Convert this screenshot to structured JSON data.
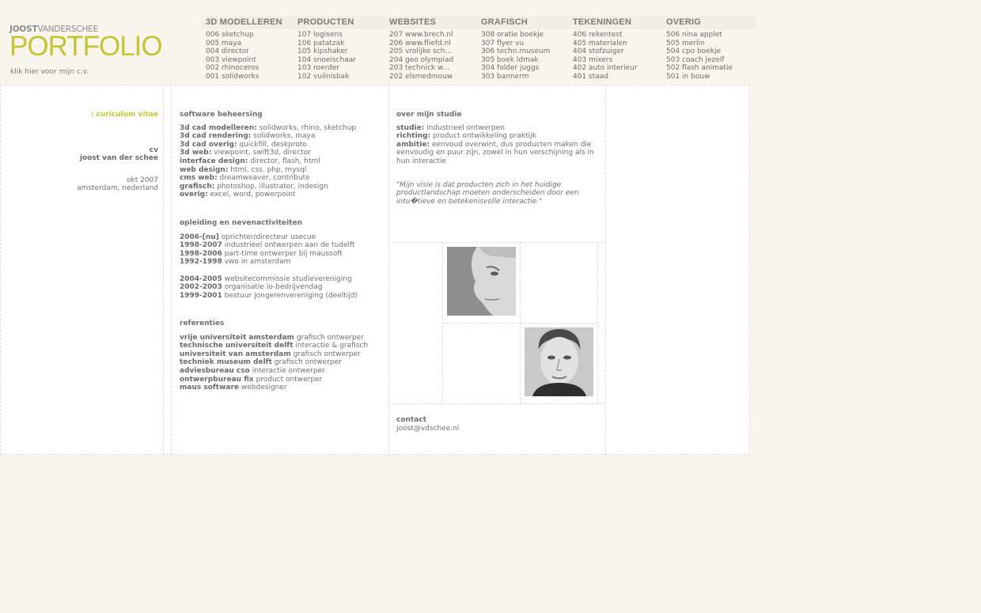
{
  "logo": {
    "top_bold": "JOOST",
    "top_thin": "VANDERSCHEE",
    "main": "PORTFOLIO"
  },
  "cv_link": "klik hier voor mijn c.v.",
  "nav": [
    {
      "title": "3D MODELLEREN",
      "items": [
        "006 sketchup",
        "005 maya",
        "004 director",
        "003 viewpoint",
        "002 rhinoceros",
        "001 solidworks"
      ]
    },
    {
      "title": "PRODUCTEN",
      "items": [
        "107 logisens",
        "106 patatzak",
        "105 kipshaker",
        "104 snoeischaar",
        "103 roerder",
        "102 vuilnisbak"
      ]
    },
    {
      "title": "WEBSITES",
      "items": [
        "207 www.brech.nl",
        "206 www.fliefd.nl",
        "205 vrolijke sch...",
        "204 geo olympiad",
        "203 technick w...",
        "202 elsmedmouw"
      ]
    },
    {
      "title": "GRAFISCH",
      "items": [
        "308 oratie boekje",
        "307 flyer vu",
        "306 techn.museum",
        "305 boek ldmak",
        "304 folder juggs",
        "303 bannerm"
      ]
    },
    {
      "title": "TEKENINGEN",
      "items": [
        "406 rekentest",
        "405 materialen",
        "404 stofzuiger",
        "403 mixers",
        "402 auto interieur",
        "401 staad"
      ]
    },
    {
      "title": "OVERIG",
      "items": [
        "506 nina applet",
        "505 merlin",
        "504 cpo boekje",
        "503 coach jezelf",
        "502 flash animatie",
        "501 in bouw"
      ]
    }
  ],
  "left": {
    "heading": ": curiculum vitae",
    "cv": "cv",
    "name": "joost van der schee",
    "date": "okt 2007",
    "location": "amsterdam, nederland"
  },
  "software": {
    "title": "software beheersing",
    "rows": [
      {
        "label": "3d cad modelleren:",
        "value": "solidworks, rhino, sketchup"
      },
      {
        "label": "3d cad rendering:",
        "value": "solidworks, maya"
      },
      {
        "label": "3d cad overig:",
        "value": "quickfill, deskproto"
      },
      {
        "label": "3d web:",
        "value": "viewpoint, swift3d, director"
      },
      {
        "label": "interface design:",
        "value": "director, flash, html"
      },
      {
        "label": "web design:",
        "value": "html, css, php, mysql"
      },
      {
        "label": "cms web:",
        "value": "dreamweaver, contribute"
      },
      {
        "label": "grafisch:",
        "value": "photoshop, illustrator, indesign"
      },
      {
        "label": "overig:",
        "value": "excel, word, powerpoint"
      }
    ]
  },
  "education": {
    "title": "opleiding en nevenactiviteiten",
    "group1": [
      {
        "label": "2006-[nu]",
        "value": "oprichter/directeur usecue"
      },
      {
        "label": "1998-2007",
        "value": "industrieel ontwerpen aan de tudelft"
      },
      {
        "label": "1998-2006",
        "value": "part-time ontwerper bij maussoft"
      },
      {
        "label": "1992-1998",
        "value": "vwo in amsterdam"
      }
    ],
    "group2": [
      {
        "label": "2004-2005",
        "value": "websitecommissie studievereniging"
      },
      {
        "label": "2002-2003",
        "value": "organisatie io-bedrijvendag"
      },
      {
        "label": "1999-2001",
        "value": "bestuur jongerenvereniging (deeltijd)"
      }
    ]
  },
  "references": {
    "title": "referenties",
    "rows": [
      {
        "label": "vrije universiteit amsterdam",
        "value": "grafisch ontwerper"
      },
      {
        "label": "technische universiteit delft",
        "value": "interactie & grafisch"
      },
      {
        "label": "universiteit van amsterdam",
        "value": "grafisch ontwerper"
      },
      {
        "label": "techniek museum delft",
        "value": "grafisch ontwerper"
      },
      {
        "label": "adviesbureau cso",
        "value": "interactie ontwerper"
      },
      {
        "label": "ontwerpbureau fix",
        "value": "product ontwerper"
      },
      {
        "label": "maus software",
        "value": "webdesigner"
      }
    ]
  },
  "study": {
    "title": "over mijn studie",
    "rows": [
      {
        "label": "studie:",
        "value": "industrieel ontwerpen"
      },
      {
        "label": "richting:",
        "value": "product ontwikkeling praktijk"
      },
      {
        "label": "ambitie:",
        "value": "eenvoud overwint, dus producten maken die eenvoudig en puur zijn, zowel in hun verschijning als in hun interactie"
      }
    ],
    "quote": "\"Mijn visie is dat producten zich in het huidige productlandschap moeten onderscheiden door een intu�tieve en betekenisvolle interactie.\""
  },
  "contact": {
    "title": "contact",
    "email": "joost@vdschee.nl"
  },
  "colors": {
    "accent": "#c6c435",
    "background": "#f8f5ec",
    "panel": "#ffffff"
  }
}
